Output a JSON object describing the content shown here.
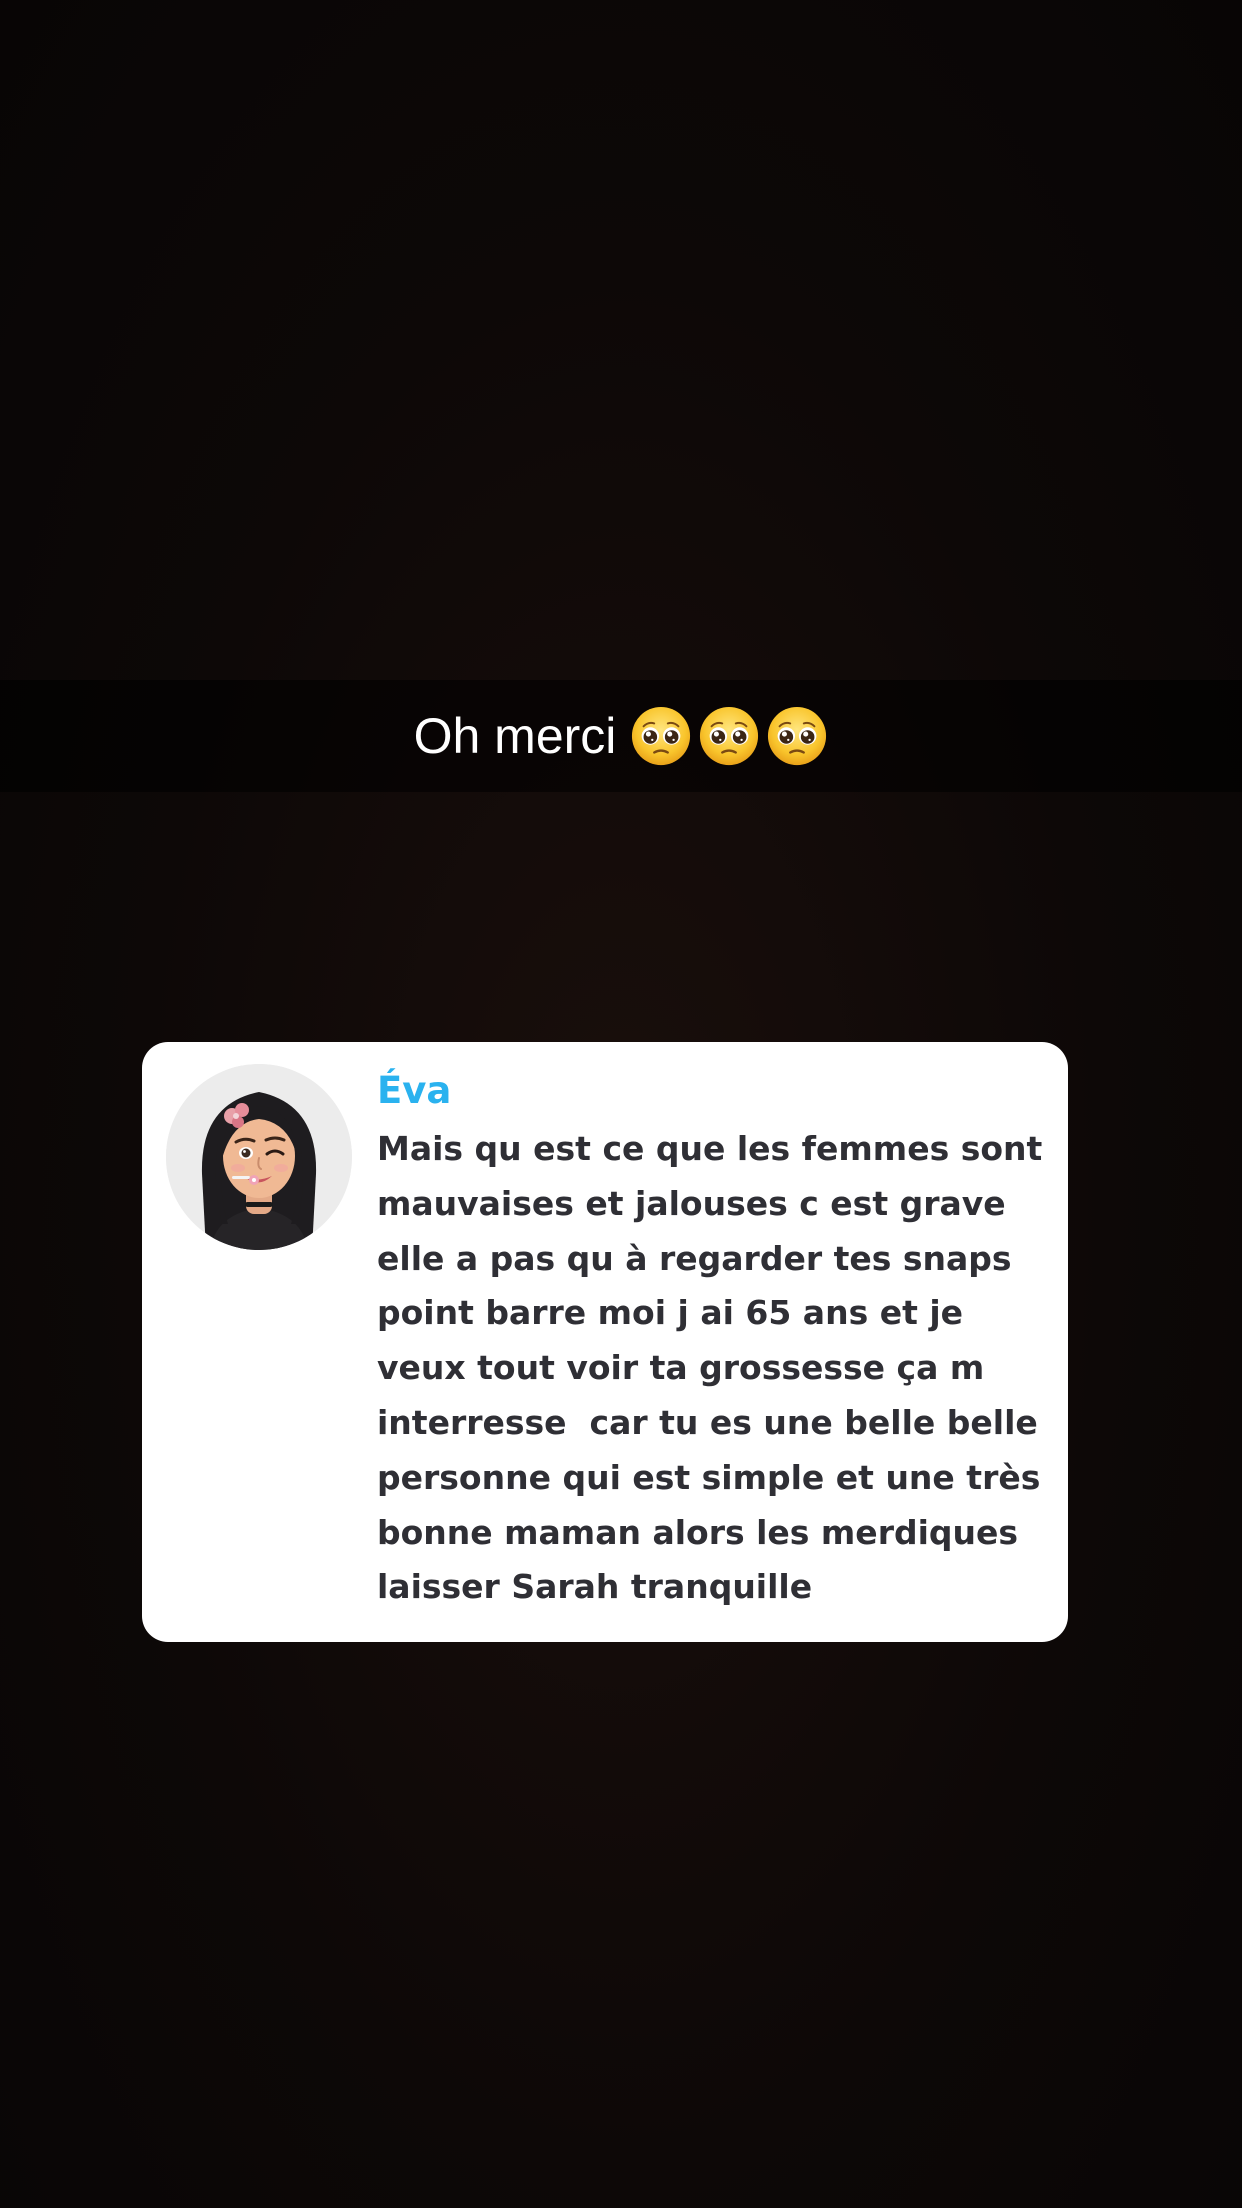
{
  "story": {
    "caption": {
      "text": "Oh merci",
      "emojis": [
        "pleading-face-emoji",
        "pleading-face-emoji",
        "pleading-face-emoji"
      ]
    },
    "question_card": {
      "sender_name": "Éva",
      "avatar": "bitmoji-avatar",
      "message_lines": [
        "Mais qu est ce que les femmes sont",
        "mauvaises et jalouses c est grave",
        "elle a pas qu à regarder tes snaps",
        "point barre moi j ai 65 ans et je",
        "veux tout voir ta grossesse ça m",
        "interresse  car tu es une belle belle",
        "personne qui est simple et une très",
        "bonne maman alors les merdiques",
        "laisser Sarah tranquille"
      ]
    }
  },
  "colors": {
    "sender_name": "#2ab2ef",
    "message_text": "#2f2f35",
    "card_background": "#ffffff",
    "story_background": "#0d0807"
  }
}
